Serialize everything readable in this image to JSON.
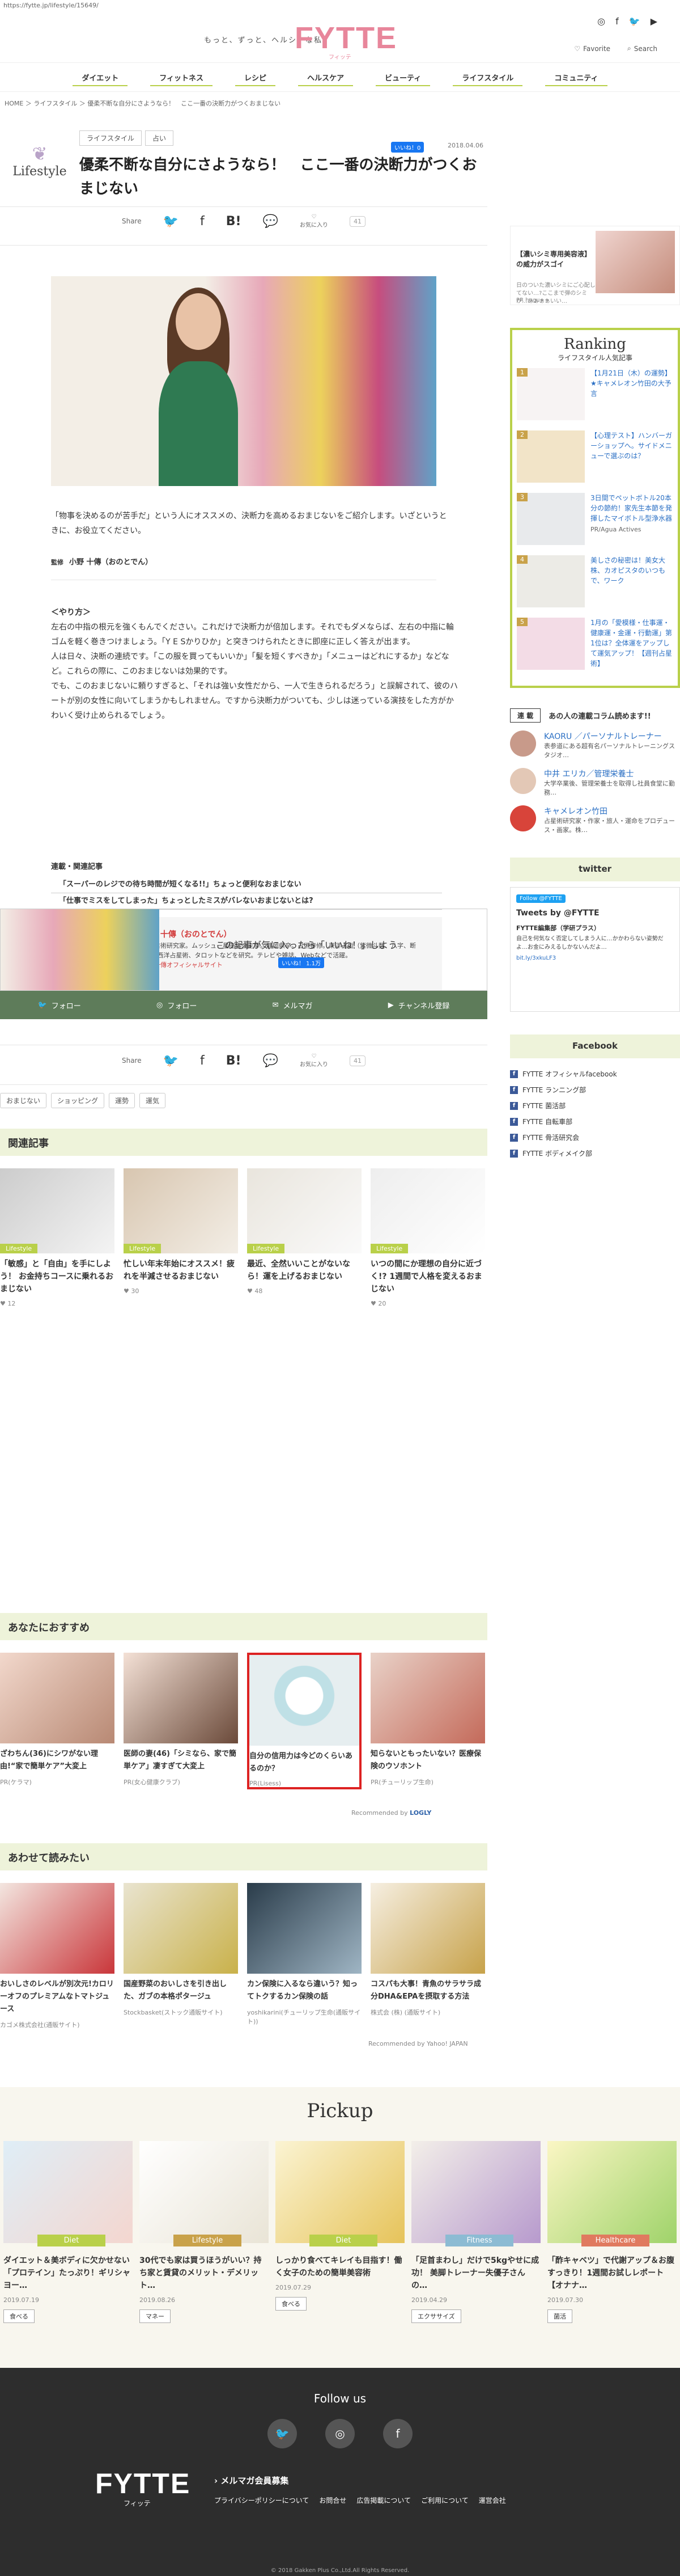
{
  "url": "https://fytte.jp/lifestyle/15649/",
  "header": {
    "tagline": "もっと、ずっと、ヘルシーな私",
    "logo": "FYTTE",
    "logo_sub": "フィッテ",
    "favorite": "Favorite",
    "search": "Search"
  },
  "nav": [
    "ダイエット",
    "フィットネス",
    "レシピ",
    "ヘルスケア",
    "ビューティ",
    "ライフスタイル",
    "コミュニティ"
  ],
  "breadcrumb": "HOME ＞ ライフスタイル ＞ 優柔不断な自分にさようなら！　ここ一番の決断力がつくおまじない",
  "article": {
    "category_logo": "Lifestyle",
    "tags": [
      "ライフスタイル",
      "占い"
    ],
    "like": "いいね！0",
    "date": "2018.04.06",
    "title": "優柔不断な自分にさようなら！　ここ一番の決断力がつくおまじない",
    "share_label": "Share",
    "fav_label": "お気に入り",
    "fav_count": "41",
    "lead": "「物事を決めるのが苦手だ」という人にオススメの、決断力を高めるおまじないをご紹介します。いざというときに、お役立てください。",
    "supervisor_label": "監修",
    "supervisor": "小野 十傳（おのとでん）",
    "body": [
      "＜やり方＞",
      "左右の中指の根元を強くもんでください。これだけで決断力が倍加します。それでもダメならば、左右の中指に輪ゴムを軽く巻きつけましょう。「Y E Sかりひか」と突きつけられたときに即座に正しく答えが出ます。",
      "人は日々、決断の連続です。「この服を買ってもいいか」「髪を短くすべきか」「メニューはどれにするか」などなど。これらの際に、このおまじないは効果的です。",
      "でも、このおまじないに頼りすぎると、「それは強い女性だから、一人で生きられるだろう」と誤解されて、彼のハートが別の女性に向いてしまうかもしれません。ですから決断力がついても、少しは迷っている演技をした方がかわいく受け止められるでしょう。"
    ],
    "related_title": "連載・関連記事",
    "related": [
      "「スーパーのレジでの待ち時間が短くなる!!」ちょっと便利なおまじない",
      "「仕事でミスをしてしまった」ちょっとしたミスがバレないおまじないとは?"
    ],
    "author_name": "小野 十傳（おのとでん）",
    "author_desc": "天文占術研究家。ムッシュー星座協会主宰。静岡県卒。占術専修。東洋占術（紫微斗数、八字、断易）、西洋占星術、タロットなどを研究。テレビや雑誌、Webなどで活躍。",
    "author_link": "小野十傳オフィシャルサイト",
    "like_banner": "この記事が気に入ったら「いいね！」しよう",
    "like_banner_btn": "いいね！ 1.1万",
    "follow": [
      "フォロー",
      "フォロー",
      "メルマガ",
      "チャンネル登録"
    ],
    "keywords": [
      "おまじない",
      "ショッピング",
      "運勢",
      "運気"
    ]
  },
  "sections": {
    "related_head": "関連記事",
    "recommend_head": "あなたにおすすめ",
    "together_head": "あわせて読みたい",
    "recommended_by": "Recommended by",
    "recommended_by_logo": "LOGLY"
  },
  "related_cards": [
    {
      "cat": "Lifestyle",
      "title": "「敏感」と「自由」を手にしよう！ お金持ちコースに乗れるおまじない",
      "meta": "12"
    },
    {
      "cat": "Lifestyle",
      "title": "忙しい年末年始にオススメ！疲れを半減させるおまじない",
      "meta": "30"
    },
    {
      "cat": "Lifestyle",
      "title": "最近、全然いいことがないなら！運を上げるおまじない",
      "meta": "48"
    },
    {
      "cat": "Lifestyle",
      "title": "いつの間にか理想の自分に近づく!? 1週間で人格を変えるおまじない",
      "meta": "20"
    }
  ],
  "recommend_cards": [
    {
      "title": "ざわちん(36)にシワがない理由!“家で簡単ケア”大変上",
      "meta": "PR(ケラマ)"
    },
    {
      "title": "医師の妻(46)「シミなら、家で簡単ケア」凄すぎて大変上",
      "meta": "PR(女心健康クラブ)"
    },
    {
      "title": "自分の信用力は今どのくらいあるのか？",
      "meta": "PR(Lisess)"
    },
    {
      "title": "知らないともったいない？医療保険のウソホント",
      "meta": "PR(チューリップ生命)"
    }
  ],
  "together_cards": [
    {
      "title": "おいしさのレベルが別次元!カロリーオフのプレミアムなトマトジュース",
      "meta": "カゴメ株式会社(通販サイト)"
    },
    {
      "title": "国産野菜のおいしさを引き出した、ガブの本格ポタージュ",
      "meta": "Stockbasket(ストック通販サイト)"
    },
    {
      "title": "カン保険に入るなら違いう？知ってトクするカン保険の話",
      "meta": "yoshikarini(チューリップ生命(通販サイト))"
    },
    {
      "title": "コスパも大事！青魚のサラサラ成分DHA&EPAを摂取する方法",
      "meta": "株式会 (株) (通販サイト)"
    }
  ],
  "together_note": "Recommended by Yahoo! JAPAN",
  "sidebar": {
    "ad_title": "【濃いシミ専用美容液】の威力がスゴイ",
    "ad_desc": "日のついた濃いシミにご心配してない…?ここまで弾のシミが…あぁぁぁいい…",
    "ad_pr": "PR hugu++",
    "ranking_title": "Ranking",
    "ranking_sub": "ライフスタイル人気記事",
    "ranking": [
      {
        "num": "1",
        "title": "【1月21日（木）の運勢】★キャメレオン竹田の大予言",
        "meta": ""
      },
      {
        "num": "2",
        "title": "【心理テスト】ハンバーガーショップへ。サイドメニューで選ぶのは？",
        "meta": ""
      },
      {
        "num": "3",
        "title": "3日間でペットボトル20本分の節約！家先生本節を発揮したマイボトル型浄水器",
        "meta": "PR/Agua Actives"
      },
      {
        "num": "4",
        "title": "美しさの秘密は！美女大株、カオピスタのいつもで、ワーク",
        "meta": ""
      },
      {
        "num": "5",
        "title": "1月の「愛模様・仕事運・健康運・金運・行動運」第1位は？全体運をアップして運気アップ！【週刊占星術】",
        "meta": ""
      }
    ],
    "serial_badge": "連 載",
    "serial_title": "あの人の連載コラム読めます!!",
    "serial": [
      {
        "name": "KAORU ／パーソナルトレーナー",
        "desc": "表参道にある超有名パーソナルトレーニングスタジオ…"
      },
      {
        "name": "中井 エリカ／管理栄養士",
        "desc": "大学卒業後、管理栄養士を取得し社員食堂に勤務…"
      },
      {
        "name": "キャメレオン竹田",
        "desc": "占星術研究家・作家・旅人・運命をプロデュース・画家。株…"
      }
    ],
    "twitter_head": "twitter",
    "twitter_follow": "Follow @FYTTE",
    "tweets_title": "Tweets by @FYTTE",
    "tweet_name": "FYTTE編集部（学研プラス）",
    "tweet_text": "自己を何気なく否定してしまう人に…かかわらない姿勢だよ…お金にみえるしかないんだよ…",
    "tweet_link": "bit.ly/3xkuLF3",
    "facebook_head": "Facebook",
    "facebook": [
      "FYTTE オフィシャルfacebook",
      "FYTTE ランニング部",
      "FYTTE 菌活部",
      "FYTTE 自転車部",
      "FYTTE 骨活研究会",
      "FYTTE ボディメイク部"
    ]
  },
  "pickup": {
    "title": "Pickup",
    "items": [
      {
        "cat": "Diet",
        "title": "ダイエット＆美ボディに欠かせない「プロテイン」たっぷり！ギリシャヨー…",
        "date": "2019.07.19",
        "tag": "食べる",
        "color": "#b9d04a"
      },
      {
        "cat": "Lifestyle",
        "title": "30代でも家は買うほうがいい？持ち家と賃貸のメリット・デメリット…",
        "date": "2019.08.26",
        "tag": "マネー",
        "color": "#c9a24a"
      },
      {
        "cat": "Diet",
        "title": "しっかり食べてキレイも目指す！働く女子のための簡単美容術",
        "date": "2019.07.29",
        "tag": "食べる",
        "color": "#b9d04a"
      },
      {
        "cat": "Fitness",
        "title": "「足首まわし」だけで5kgやせに成功！ 美脚トレーナー失優子さんの…",
        "date": "2019.04.29",
        "tag": "エクササイズ",
        "color": "#8cbbd3"
      },
      {
        "cat": "Healthcare",
        "title": "「酢キャベツ」で代謝アップ＆お腹すっきり！1週間お試しレポート【オナナ…",
        "date": "2019.07.30",
        "tag": "菌活",
        "color": "#e07a5f"
      }
    ]
  },
  "footer": {
    "follow": "Follow us",
    "logo": "FYTTE",
    "logo_sub": "フィッテ",
    "mailmag": "メルマガ会員募集",
    "links": [
      "プライバシーポリシーについて",
      "お問合せ",
      "広告掲載について",
      "ご利用について",
      "運営会社"
    ],
    "copy": "© 2018 Gakken Plus Co.,Ltd.All Rights Reserved."
  }
}
